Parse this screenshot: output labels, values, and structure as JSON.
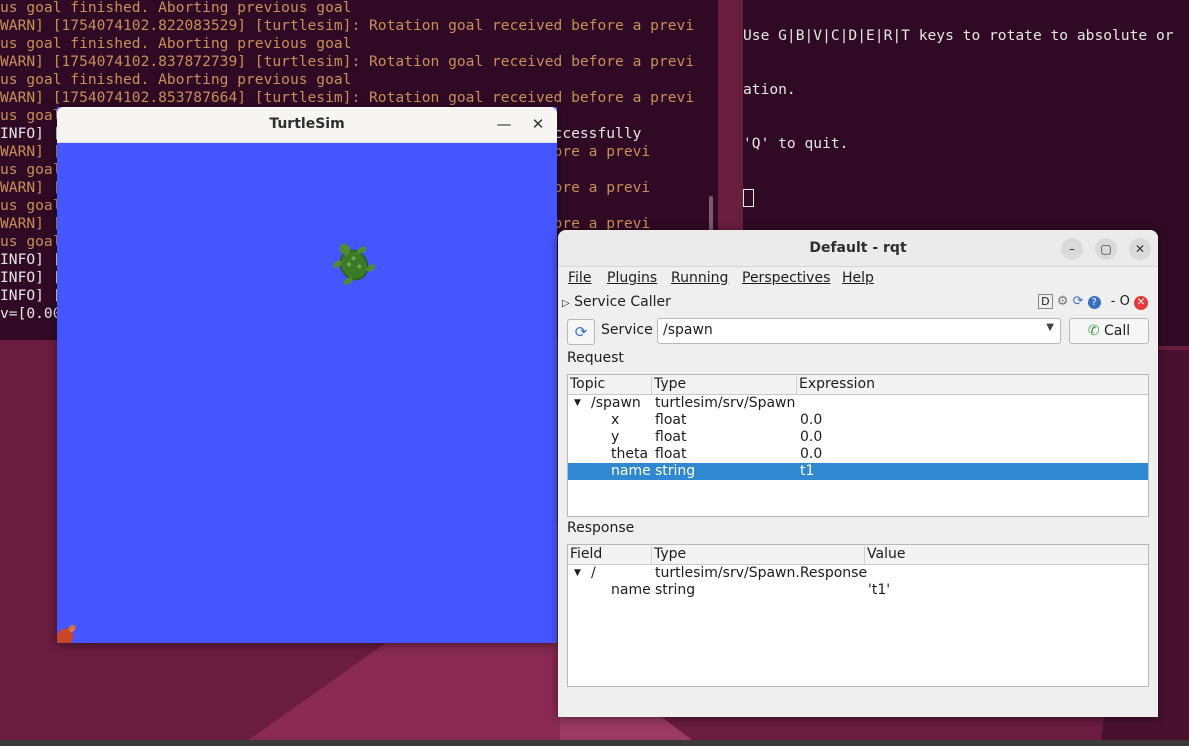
{
  "terminal_left": {
    "lines": [
      {
        "text": "us goal finished. Aborting previous goal",
        "warn": true
      },
      {
        "text": "WARN] [1754074102.822083529] [turtlesim]: Rotation goal received before a previ",
        "warn": true
      },
      {
        "text": "us goal finished. Aborting previous goal",
        "warn": true
      },
      {
        "text": "WARN] [1754074102.837872739] [turtlesim]: Rotation goal received before a previ",
        "warn": true
      },
      {
        "text": "us goal finished. Aborting previous goal",
        "warn": true
      },
      {
        "text": "WARN] [1754074102.853787664] [turtlesim]: Rotation goal received before a previ",
        "warn": true
      },
      {
        "text": "us goal finished. Aborting previous goal",
        "warn": true
      },
      {
        "text": "INFO] [                                                  ted successfully",
        "warn": false
      },
      {
        "text": "WARN] [                                                  ed before a previ",
        "warn": true
      },
      {
        "text": "us goal",
        "warn": true
      },
      {
        "text": "WARN] [                                                  ed before a previ",
        "warn": true
      },
      {
        "text": "us goal",
        "warn": true
      },
      {
        "text": "WARN] [                                                  ed before a previ",
        "warn": true
      },
      {
        "text": "us goal",
        "warn": true
      },
      {
        "text": "INFO] [",
        "warn": false
      },
      {
        "text": "INFO] [",
        "warn": false
      },
      {
        "text": "INFO] [",
        "warn": false
      },
      {
        "text": "v=[0.00",
        "warn": false
      }
    ]
  },
  "terminal_right": {
    "line1": "Use G|B|V|C|D|E|R|T keys to rotate to absolute or",
    "line2": "ation.",
    "line3": "'Q' to quit."
  },
  "turtlesim": {
    "title": "TurtleSim",
    "minimize": "—",
    "close": "✕"
  },
  "rqt": {
    "title": "Default - rqt",
    "menus": [
      "File",
      "Plugins",
      "Running",
      "Perspectives",
      "Help"
    ],
    "plugin_name": "Service Caller",
    "plugin_controls": "D ⚙ ⟳ ? - O",
    "service_label": "Service",
    "service_value": "/spawn",
    "call_label": "Call",
    "request_label": "Request",
    "request_headers": [
      "Topic",
      "Type",
      "Expression"
    ],
    "request_rows": [
      {
        "topic": "/spawn",
        "type": "turtlesim/srv/Spawn",
        "expr": "",
        "expander": true
      },
      {
        "topic": "x",
        "type": "float",
        "expr": "0.0"
      },
      {
        "topic": "y",
        "type": "float",
        "expr": "0.0"
      },
      {
        "topic": "theta",
        "type": "float",
        "expr": "0.0"
      },
      {
        "topic": "name",
        "type": "string",
        "expr": "t1",
        "selected": true
      }
    ],
    "response_label": "Response",
    "response_headers": [
      "Field",
      "Type",
      "Value"
    ],
    "response_rows": [
      {
        "field": "/",
        "type": "turtlesim/srv/Spawn.Response",
        "value": "",
        "expander": true
      },
      {
        "field": "name",
        "type": "string",
        "value": "'t1'"
      }
    ]
  },
  "colors": {
    "terminal_bg": "#300a24",
    "warn_text": "#c6905a",
    "turtlesim_bg": "#4556ff",
    "selection": "#3089d0"
  }
}
